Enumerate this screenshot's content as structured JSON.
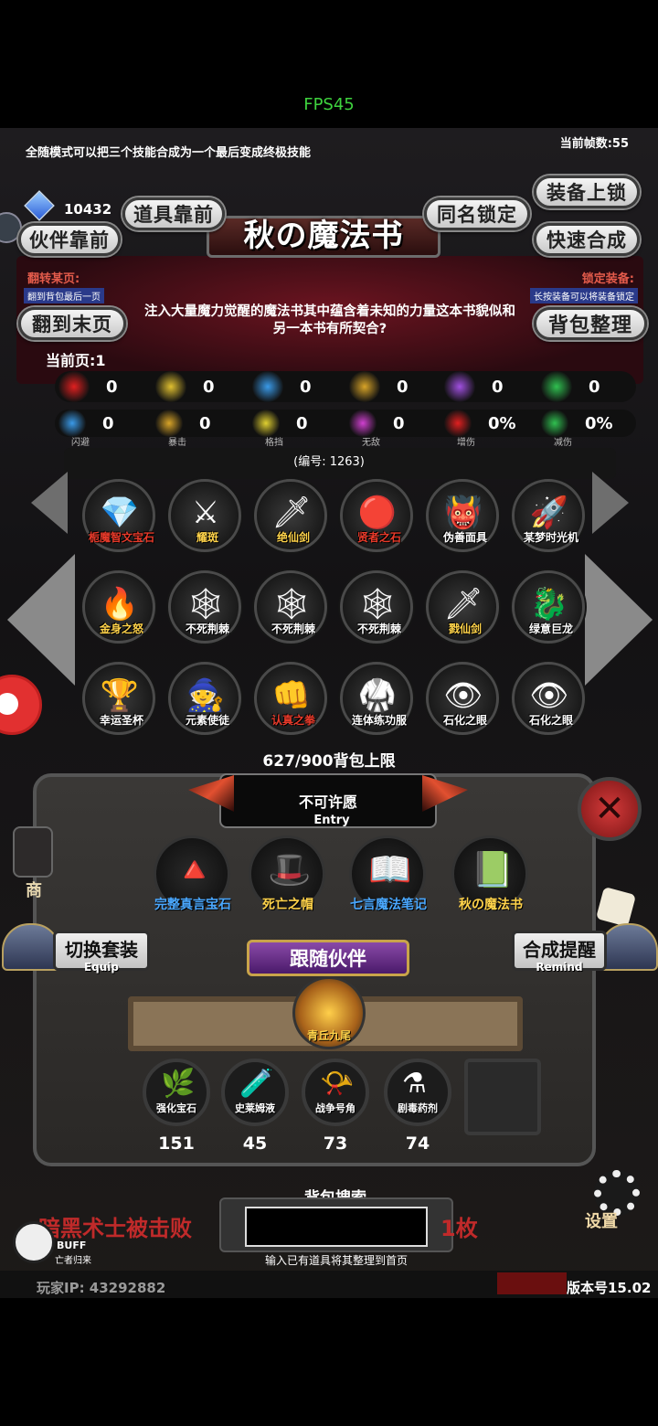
{
  "status": {
    "fps": "FPS45"
  },
  "top": {
    "hint": "全随模式可以把三个技能合成为一个最后变成终极技能",
    "current_fps": "当前帧数:55"
  },
  "header": {
    "gem_count": "10432",
    "title": "秋の魔法书",
    "btn_item_front": "道具靠前",
    "btn_same_lock": "同名锁定",
    "btn_equip_lock": "装备上锁",
    "btn_partner_front": "伙伴靠前",
    "btn_quick_merge": "快速合成",
    "flip_title": "翻转某页:",
    "flip_sub": "翻到背包最后一页",
    "lock_title": "锁定装备:",
    "lock_sub": "长按装备可以将装备锁定",
    "btn_last_page": "翻到末页",
    "btn_sort": "背包整理",
    "description": "注入大量魔力觉醒的魔法书其中蕴含着未知的力量这本书貌似和另一本书有所契合?"
  },
  "page": {
    "label": "当前页:1"
  },
  "stats_row1": [
    {
      "icon": "heart-icon",
      "value": "0",
      "color": "#e02020"
    },
    {
      "icon": "body-icon",
      "value": "0",
      "color": "#e0c030"
    },
    {
      "icon": "helmet-icon",
      "value": "0",
      "color": "#3a9ae8"
    },
    {
      "icon": "bow-icon",
      "value": "0",
      "color": "#d8a428"
    },
    {
      "icon": "lightning-icon",
      "value": "0",
      "color": "#a050e0"
    },
    {
      "icon": "clover-icon",
      "value": "0",
      "color": "#30c050"
    }
  ],
  "stats_row2": [
    {
      "icon": "dodge-icon",
      "value": "0",
      "label": "闪避",
      "color": "#3a9ae8"
    },
    {
      "icon": "crit-icon",
      "value": "0",
      "label": "暴击",
      "color": "#d8a428"
    },
    {
      "icon": "block-icon",
      "value": "0",
      "label": "格挡",
      "color": "#e0d030"
    },
    {
      "icon": "invincible-icon",
      "value": "0",
      "label": "无敌",
      "color": "#d040d0"
    },
    {
      "icon": "damage-up-icon",
      "value": "0%",
      "label": "增伤",
      "color": "#e02020"
    },
    {
      "icon": "damage-down-icon",
      "value": "0%",
      "label": "减伤",
      "color": "#30c050"
    }
  ],
  "item_id": "(编号: 1263)",
  "items": [
    {
      "name": "栀魔智文宝石",
      "color": "#e83a2a",
      "glyph": "💎"
    },
    {
      "name": "耀斑",
      "color": "#ffd34a",
      "glyph": "⚔"
    },
    {
      "name": "绝仙剑",
      "color": "#ffd34a",
      "glyph": "🗡"
    },
    {
      "name": "贤者之石",
      "color": "#e83a2a",
      "glyph": "🔴"
    },
    {
      "name": "伪善面具",
      "color": "#ffffff",
      "glyph": "👹"
    },
    {
      "name": "某梦时光机",
      "color": "#ffffff",
      "glyph": "🚀"
    },
    {
      "name": "金身之怒",
      "color": "#ffd34a",
      "glyph": "🔥"
    },
    {
      "name": "不死荆棘",
      "color": "#ffffff",
      "glyph": "🕸"
    },
    {
      "name": "不死荆棘",
      "color": "#ffffff",
      "glyph": "🕸"
    },
    {
      "name": "不死荆棘",
      "color": "#ffffff",
      "glyph": "🕸"
    },
    {
      "name": "戮仙剑",
      "color": "#ffd34a",
      "glyph": "🗡"
    },
    {
      "name": "绿意巨龙",
      "color": "#ffffff",
      "glyph": "🐉"
    },
    {
      "name": "幸运圣杯",
      "color": "#ffffff",
      "glyph": "🏆"
    },
    {
      "name": "元素使徒",
      "color": "#ffffff",
      "glyph": "🧙"
    },
    {
      "name": "认真之拳",
      "color": "#e83a2a",
      "glyph": "👊"
    },
    {
      "name": "连体练功服",
      "color": "#ffffff",
      "glyph": "🥋"
    },
    {
      "name": "石化之眼",
      "color": "#ffffff",
      "glyph": "👁"
    },
    {
      "name": "石化之眼",
      "color": "#ffffff",
      "glyph": "👁"
    }
  ],
  "capacity": "627/900背包上限",
  "entry": {
    "title": "不可许愿",
    "sub": "Entry"
  },
  "entries": [
    {
      "name": "完整真言宝石",
      "color": "#4aa8ff",
      "glyph": "🔺"
    },
    {
      "name": "死亡之帽",
      "color": "#ffd34a",
      "glyph": "🎩"
    },
    {
      "name": "七言魔法笔记",
      "color": "#4aa8ff",
      "glyph": "📖"
    },
    {
      "name": "秋の魔法书",
      "color": "#ffd34a",
      "glyph": "📗"
    }
  ],
  "equip_tab": {
    "label": "切换套装",
    "sub": "Equip"
  },
  "remind_tab": {
    "label": "合成提醒",
    "sub": "Remind"
  },
  "follow": {
    "label": "跟随伙伴",
    "partner": "青丘九尾"
  },
  "materials": [
    {
      "name": "强化宝石",
      "count": "151",
      "glyph": "🌿"
    },
    {
      "name": "史莱姆液",
      "count": "45",
      "glyph": "🧪"
    },
    {
      "name": "战争号角",
      "count": "73",
      "glyph": "📯"
    },
    {
      "name": "剧毒药剂",
      "count": "74",
      "glyph": "⚗"
    }
  ],
  "search": {
    "label": "背包搜索",
    "hint": "输入已有道具将其整理到首页"
  },
  "bottom": {
    "news": "暗黑术士被击败",
    "news_right": "1枚",
    "buff": "BUFF",
    "buff_sub": "亡者归来",
    "player_ip": "玩家IP: 43292882",
    "version": "版本号15.02",
    "side_shop": "商",
    "side_settings": "设置"
  }
}
